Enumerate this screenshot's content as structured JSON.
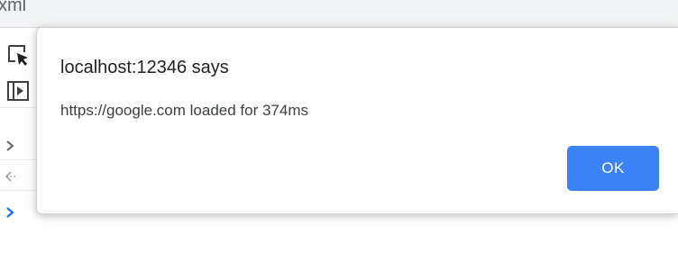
{
  "background": {
    "top_text": "xml"
  },
  "devtools": {
    "icons": [
      {
        "name": "inspect-element-icon"
      },
      {
        "name": "toggle-device-toolbar-icon"
      }
    ],
    "console_rows": [
      {
        "icon": "chevron-right-icon",
        "color": "#5f6368"
      },
      {
        "icon": "return-arrow-icon",
        "color": "#9aa0a6"
      },
      {
        "icon": "prompt-chevron-icon",
        "color": "#1a73e8"
      }
    ]
  },
  "dialog": {
    "title": "localhost:12346 says",
    "message": "https://google.com loaded for 374ms",
    "ok_label": "OK",
    "accent": "#3b82f6"
  }
}
